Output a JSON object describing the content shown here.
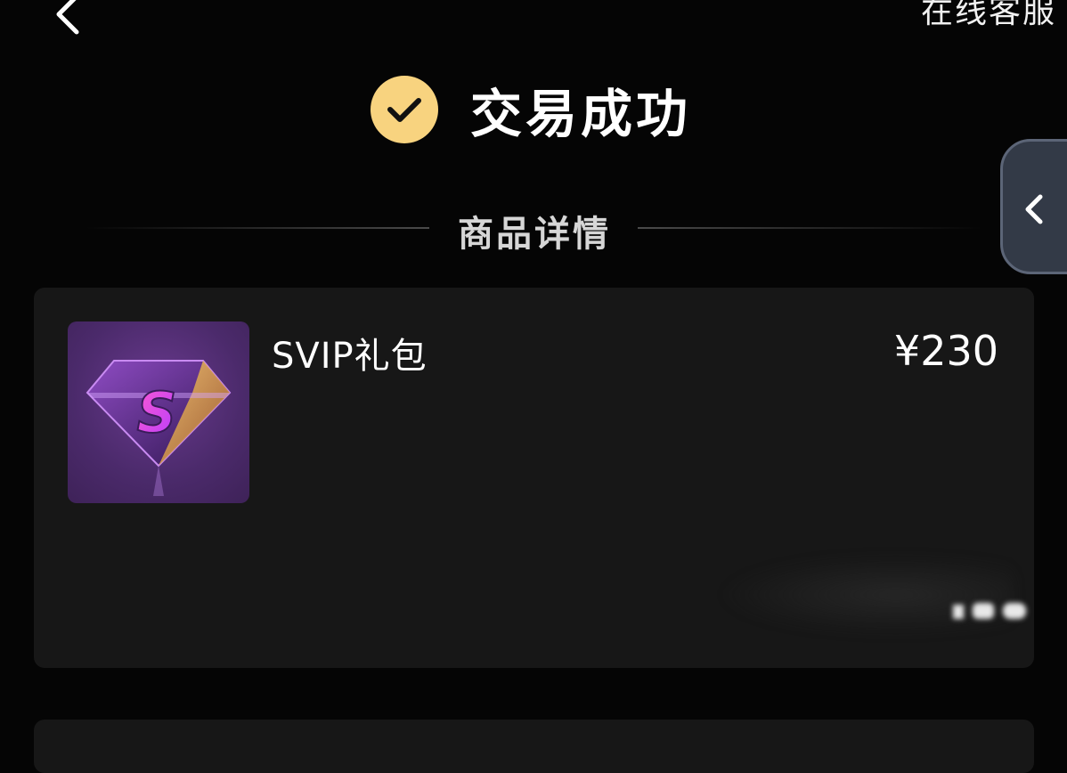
{
  "header": {
    "back_icon": "chevron-left-icon",
    "service_label": "在线客服"
  },
  "status": {
    "icon": "check-circle-icon",
    "icon_color": "#f8d37f",
    "text": "交易成功"
  },
  "section": {
    "title": "商品详情"
  },
  "side_tab": {
    "icon": "chevron-left-icon"
  },
  "product": {
    "thumbnail_icon": "svip-diamond-icon",
    "name": "SVIP礼包",
    "price": "¥230"
  },
  "colors": {
    "background": "#050505",
    "card": "#171717",
    "accent": "#f8d37f",
    "side_tab": "#333a47"
  }
}
